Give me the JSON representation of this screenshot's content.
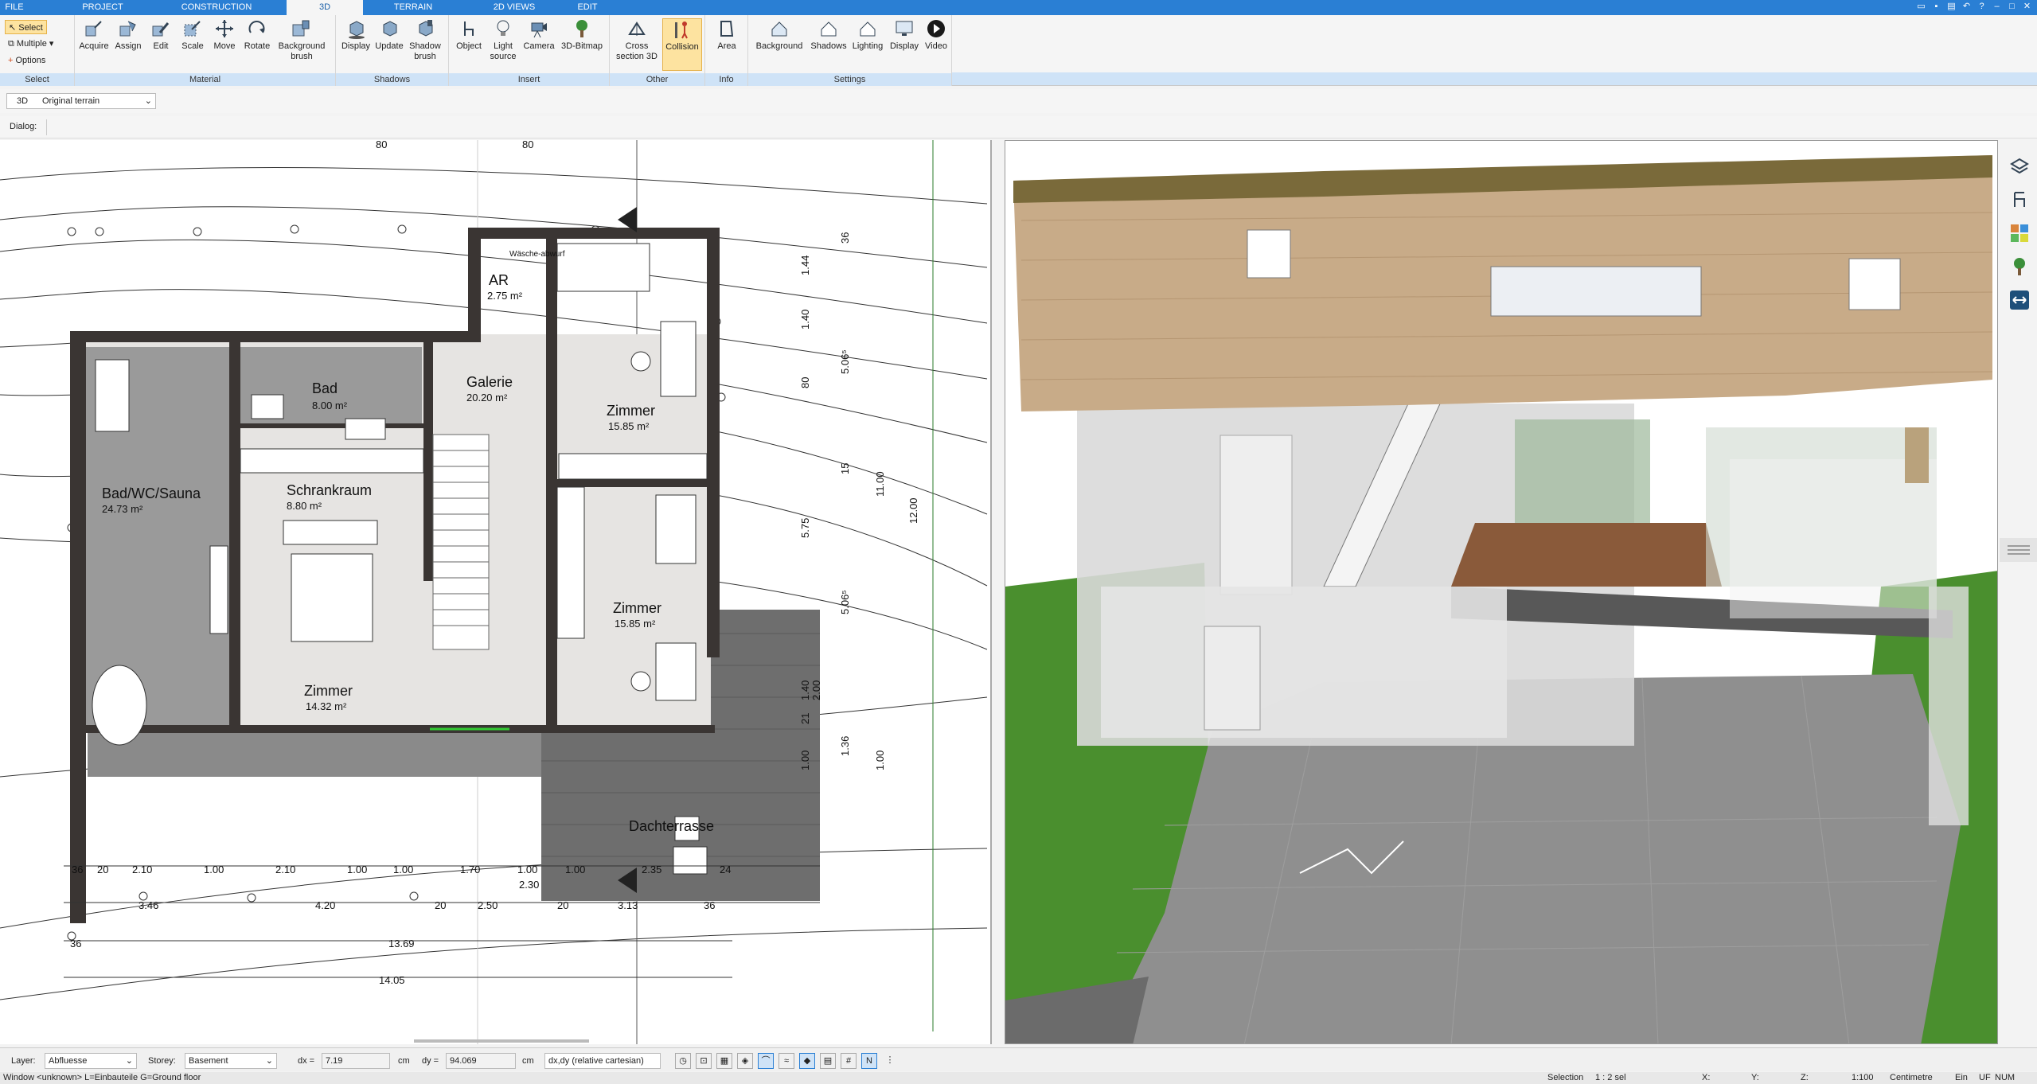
{
  "menu": {
    "tabs": [
      "FILE",
      "PROJECT",
      "CONSTRUCTION",
      "3D",
      "TERRAIN",
      "2D VIEWS",
      "EDIT"
    ],
    "active": "3D"
  },
  "ribbon": {
    "select_group": {
      "select": "Select",
      "multiple": "Multiple",
      "options": "Options",
      "label": "Select"
    },
    "material": {
      "buttons": [
        "Acquire",
        "Assign",
        "Edit",
        "Scale",
        "Move",
        "Rotate",
        "Background brush"
      ],
      "label": "Material"
    },
    "shadows": {
      "buttons": [
        "Display",
        "Update",
        "Shadow brush"
      ],
      "label": "Shadows"
    },
    "insert": {
      "buttons": [
        "Object",
        "Light source",
        "Camera",
        "3D-Bitmap"
      ],
      "label": "Insert"
    },
    "other": {
      "buttons": [
        "Cross section 3D",
        "Collision"
      ],
      "label": "Other"
    },
    "info": {
      "buttons": [
        "Area"
      ],
      "label": "Info"
    },
    "settings": {
      "buttons": [
        "Background",
        "Shadows",
        "Lighting",
        "Display",
        "Video"
      ],
      "label": "Settings"
    }
  },
  "toolbar": {
    "mode": "3D",
    "terrain_value": "Original terrain",
    "dialog_label": "Dialog:"
  },
  "plan": {
    "rooms": [
      {
        "name": "Bad",
        "area": "8.00 m²"
      },
      {
        "name": "Galerie",
        "area": "20.20 m²"
      },
      {
        "name": "AR",
        "area": "2.75 m²"
      },
      {
        "name": "Zimmer",
        "area": "15.85 m²"
      },
      {
        "name": "Bad/WC/Sauna",
        "area": "24.73 m²"
      },
      {
        "name": "Schrankraum",
        "area": "8.80 m²"
      },
      {
        "name": "Zimmer",
        "area": "15.85 m²"
      },
      {
        "name": "Zimmer",
        "area": "14.32 m²"
      },
      {
        "name": "Dachterrasse",
        "area": ""
      }
    ],
    "misc_label": "Wäsche-abwurf",
    "top_dims": [
      "80",
      "80"
    ],
    "right_dims": [
      "36",
      "1.44",
      "1.40",
      "80",
      "5.06⁵",
      "15",
      "11.00",
      "5.75",
      "12.00",
      "5.06⁵",
      "1.40",
      "2.00",
      "21",
      "1.00",
      "1.36",
      "1.00"
    ],
    "bottom_dims_row1": [
      "36",
      "20",
      "2.10",
      "1.00",
      "2.10",
      "1.00",
      "1.00",
      "1.70",
      "1.00",
      "1.00",
      "2.35",
      "24"
    ],
    "bottom_dims_row2": [
      "3.46",
      "4.20",
      "20",
      "2.50",
      "2.30",
      "20",
      "3.13",
      "36"
    ],
    "total_dims": [
      "13.69",
      "14.05"
    ]
  },
  "status": {
    "layer_label": "Layer:",
    "layer_value": "Abfluesse",
    "storey_label": "Storey:",
    "storey_value": "Basement",
    "dx_label": "dx =",
    "dx_value": "7.19",
    "dx_unit": "cm",
    "dy_label": "dy =",
    "dy_value": "94.069",
    "dy_unit": "cm",
    "coord_mode": "dx,dy (relative cartesian)"
  },
  "footer": {
    "window": "Window <unknown> L=Einbauteile G=Ground floor",
    "selection": "Selection",
    "sel_value": "1 : 2 sel",
    "x": "X:",
    "y": "Y:",
    "z": "Z:",
    "scale": "1:100",
    "unit": "Centimetre",
    "ein": "Ein",
    "uf": "UF",
    "num": "NUM"
  },
  "colors": {
    "accent": "#2a7fd4",
    "wall": "#3a3533",
    "grass": "#4a8f2e"
  }
}
